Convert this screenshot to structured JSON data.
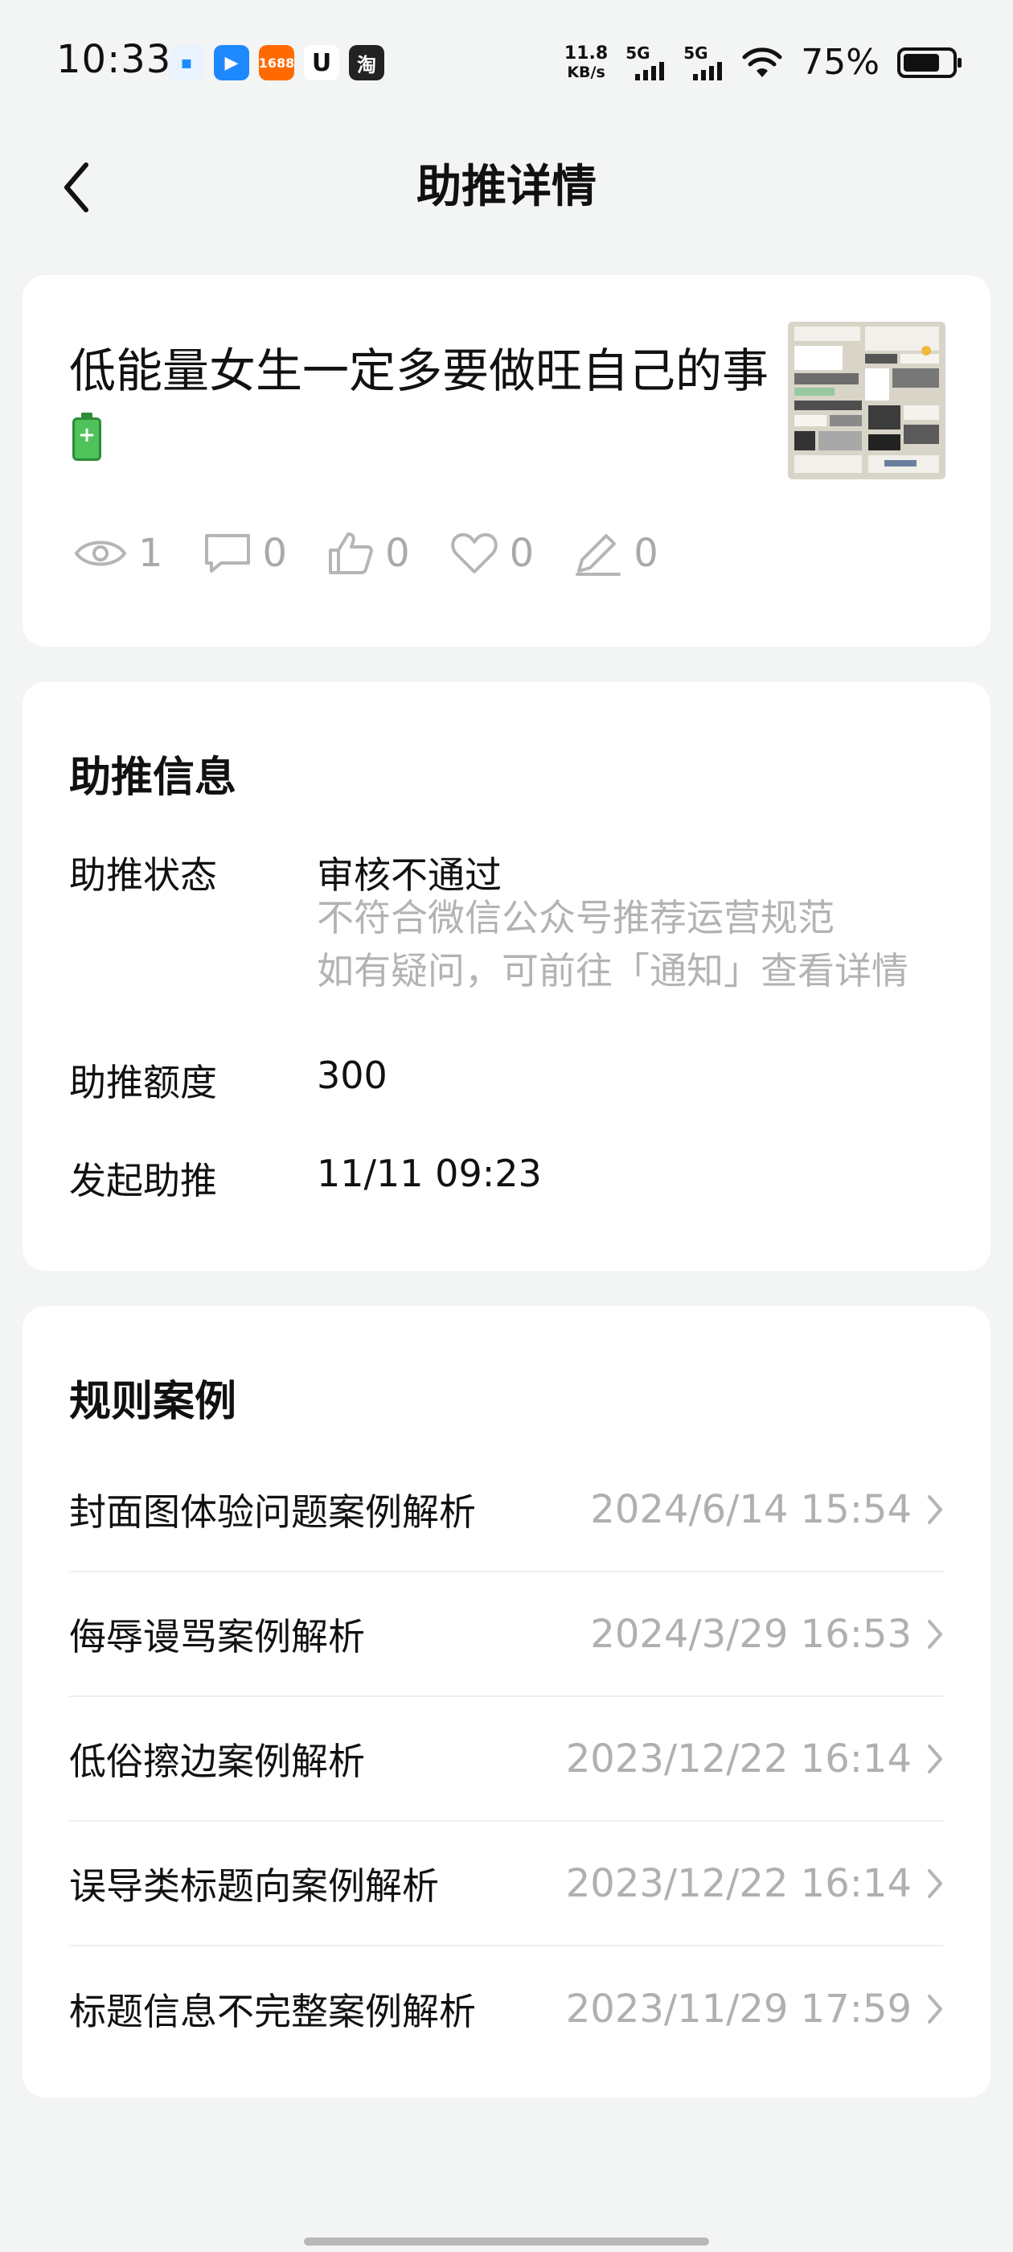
{
  "status_bar": {
    "time": "10:33",
    "app_icons": [
      {
        "name": "app-icon-1",
        "glyph": "▪"
      },
      {
        "name": "app-icon-2",
        "glyph": "▶"
      },
      {
        "name": "app-icon-3",
        "glyph": "1688"
      },
      {
        "name": "app-icon-4",
        "glyph": "ᑌ"
      },
      {
        "name": "app-icon-5",
        "glyph": "淘"
      }
    ],
    "net_speed": "11.8",
    "net_speed_unit": "KB/s",
    "signal_1_label": "5G",
    "signal_2_label": "5G",
    "battery_percent": "75%",
    "battery_level": 0.75
  },
  "header": {
    "title": "助推详情",
    "back_icon": "chevron-left-icon"
  },
  "article": {
    "title": "低能量女生一定多要做旺自己的事",
    "title_emoji": "battery-icon",
    "stats": {
      "views": "1",
      "comments": "0",
      "likes": "0",
      "favorites": "0",
      "edits": "0"
    }
  },
  "boost_info": {
    "section_title": "助推信息",
    "status_label": "助推状态",
    "status_value": "审核不通过",
    "status_note_1": "不符合微信公众号推荐运营规范",
    "status_note_2": "如有疑问，可前往「通知」查看详情",
    "quota_label": "助推额度",
    "quota_value": "300",
    "start_label": "发起助推",
    "start_value": "11/11 09:23"
  },
  "rules": {
    "section_title": "规则案例",
    "items": [
      {
        "name": "封面图体验问题案例解析",
        "date": "2024/6/14 15:54"
      },
      {
        "name": "侮辱谩骂案例解析",
        "date": "2024/3/29 16:53"
      },
      {
        "name": "低俗擦边案例解析",
        "date": "2023/12/22 16:14"
      },
      {
        "name": "误导类标题向案例解析",
        "date": "2023/12/22 16:14"
      },
      {
        "name": "标题信息不完整案例解析",
        "date": "2023/11/29 17:59"
      }
    ]
  },
  "colors": {
    "background": "#f3f5f4",
    "card": "#ffffff",
    "muted_text": "#b0b0b0",
    "battery_green": "#4fc25a"
  }
}
